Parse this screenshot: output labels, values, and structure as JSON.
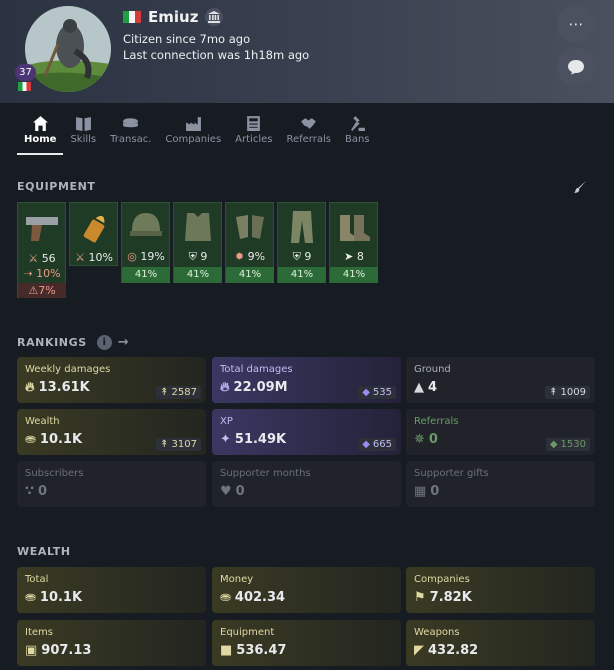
{
  "profile": {
    "name": "Emiuz",
    "level": "37",
    "citizen_since": "Citizen since 7mo ago",
    "last_connection": "Last connection was 1h18m ago"
  },
  "tabs": [
    {
      "label": "Home",
      "icon": "home-icon",
      "active": true
    },
    {
      "label": "Skills",
      "icon": "book-icon"
    },
    {
      "label": "Transac.",
      "icon": "coins-icon"
    },
    {
      "label": "Companies",
      "icon": "factory-icon"
    },
    {
      "label": "Articles",
      "icon": "newspaper-icon"
    },
    {
      "label": "Referrals",
      "icon": "handshake-icon"
    },
    {
      "label": "Bans",
      "icon": "gavel-icon"
    }
  ],
  "equipment": {
    "title": "EQUIPMENT",
    "items": [
      {
        "slot": "weapon",
        "stats": [
          "56",
          "10%"
        ],
        "warning": "7%"
      },
      {
        "slot": "ammo",
        "stats": [
          "10%"
        ]
      },
      {
        "slot": "helmet",
        "stats": [
          "19%"
        ],
        "durability": "41%"
      },
      {
        "slot": "chest",
        "stats": [
          "9"
        ],
        "durability": "41%"
      },
      {
        "slot": "gloves",
        "stats": [
          "9%"
        ],
        "durability": "41%"
      },
      {
        "slot": "pants",
        "stats": [
          "9"
        ],
        "durability": "41%"
      },
      {
        "slot": "boots",
        "stats": [
          "8"
        ],
        "durability": "41%"
      }
    ]
  },
  "rankings": {
    "title": "RANKINGS",
    "cards": [
      {
        "label": "Weekly damages",
        "value": "13.61K",
        "rank": "2587"
      },
      {
        "label": "Total damages",
        "value": "22.09M",
        "rank": "535"
      },
      {
        "label": "Ground",
        "value": "4",
        "rank": "1009"
      },
      {
        "label": "Wealth",
        "value": "10.1K",
        "rank": "3107"
      },
      {
        "label": "XP",
        "value": "51.49K",
        "rank": "665"
      },
      {
        "label": "Referrals",
        "value": "0",
        "rank": "1530"
      },
      {
        "label": "Subscribers",
        "value": "0"
      },
      {
        "label": "Supporter months",
        "value": "0"
      },
      {
        "label": "Supporter gifts",
        "value": "0"
      }
    ]
  },
  "wealth": {
    "title": "WEALTH",
    "cards": [
      {
        "label": "Total",
        "value": "10.1K"
      },
      {
        "label": "Money",
        "value": "402.34"
      },
      {
        "label": "Companies",
        "value": "7.82K"
      },
      {
        "label": "Items",
        "value": "907.13"
      },
      {
        "label": "Equipment",
        "value": "536.47"
      },
      {
        "label": "Weapons",
        "value": "432.82"
      }
    ]
  }
}
